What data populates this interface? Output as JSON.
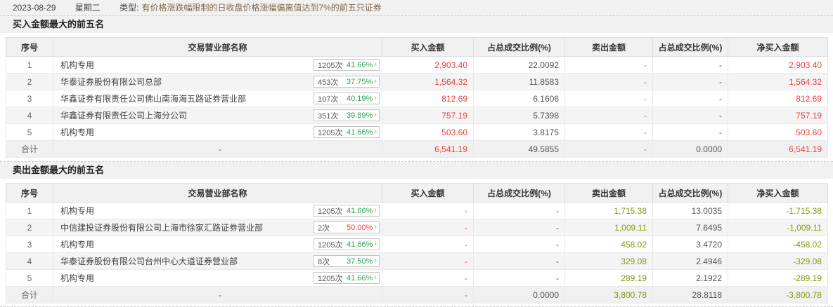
{
  "header": {
    "date": "2023-08-29",
    "weekday": "星期二",
    "type_label": "类型:",
    "type_desc": "有价格涨跌幅限制的日收盘价格涨幅偏离值达到7%的前五只证券"
  },
  "colors": {
    "buy_red": "#f43c3c",
    "sell_green": "#7f9d0e",
    "badge_green": "#2fa052",
    "value_gray": "#555555",
    "type_brown": "#7d6a43"
  },
  "table_columns": [
    "序号",
    "交易营业部名称",
    "买入金额",
    "占总成交比例(%)",
    "卖出金额",
    "占总成交比例(%)",
    "净买入金额"
  ],
  "tables": [
    {
      "title": "买入金额最大的前五名",
      "rows": [
        {
          "no": "1",
          "name": "机构专用",
          "times": "1205次",
          "pct": "41.66%",
          "pct_color": "green",
          "buy": "2,903.40",
          "buy_pct": "22.0092",
          "sell": "-",
          "sell_pct": "-",
          "net": "2,903.40"
        },
        {
          "no": "2",
          "name": "华泰证券股份有限公司总部",
          "times": "453次",
          "pct": "37.75%",
          "pct_color": "green",
          "buy": "1,564.32",
          "buy_pct": "11.8583",
          "sell": "-",
          "sell_pct": "-",
          "net": "1,564.32"
        },
        {
          "no": "3",
          "name": "华鑫证券有限责任公司佛山南海海五路证券营业部",
          "times": "107次",
          "pct": "40.19%",
          "pct_color": "green",
          "buy": "812.69",
          "buy_pct": "6.1606",
          "sell": "-",
          "sell_pct": "-",
          "net": "812.69"
        },
        {
          "no": "4",
          "name": "华鑫证券有限责任公司上海分公司",
          "times": "351次",
          "pct": "39.89%",
          "pct_color": "green",
          "buy": "757.19",
          "buy_pct": "5.7398",
          "sell": "-",
          "sell_pct": "-",
          "net": "757.19"
        },
        {
          "no": "5",
          "name": "机构专用",
          "times": "1205次",
          "pct": "41.66%",
          "pct_color": "green",
          "buy": "503.60",
          "buy_pct": "3.8175",
          "sell": "-",
          "sell_pct": "-",
          "net": "503.60"
        }
      ],
      "total": {
        "no": "合计",
        "name": "-",
        "buy": "6,541.19",
        "buy_pct": "49.5855",
        "sell": "-",
        "sell_pct": "0.0000",
        "net": "6,541.19"
      }
    },
    {
      "title": "卖出金额最大的前五名",
      "rows": [
        {
          "no": "1",
          "name": "机构专用",
          "times": "1205次",
          "pct": "41.66%",
          "pct_color": "green",
          "buy": "-",
          "buy_pct": "-",
          "sell": "1,715.38",
          "sell_pct": "13.0035",
          "net": "-1,715.38"
        },
        {
          "no": "2",
          "name": "中信建投证券股份有限公司上海市徐家汇路证券营业部",
          "times": "2次",
          "pct": "50.00%",
          "pct_color": "red",
          "buy": "-",
          "buy_pct": "-",
          "sell": "1,009.11",
          "sell_pct": "7.6495",
          "net": "-1,009.11"
        },
        {
          "no": "3",
          "name": "机构专用",
          "times": "1205次",
          "pct": "41.66%",
          "pct_color": "green",
          "buy": "-",
          "buy_pct": "-",
          "sell": "458.02",
          "sell_pct": "3.4720",
          "net": "-458.02"
        },
        {
          "no": "4",
          "name": "华泰证券股份有限公司台州中心大道证券营业部",
          "times": "8次",
          "pct": "37.50%",
          "pct_color": "green",
          "buy": "-",
          "buy_pct": "-",
          "sell": "329.08",
          "sell_pct": "2.4946",
          "net": "-329.08"
        },
        {
          "no": "5",
          "name": "机构专用",
          "times": "1205次",
          "pct": "41.66%",
          "pct_color": "green",
          "buy": "-",
          "buy_pct": "-",
          "sell": "289.19",
          "sell_pct": "2.1922",
          "net": "-289.19"
        }
      ],
      "total": {
        "no": "合计",
        "name": "-",
        "buy": "-",
        "buy_pct": "0.0000",
        "sell": "3,800.78",
        "sell_pct": "28.8118",
        "net": "-3,800.78"
      }
    }
  ]
}
